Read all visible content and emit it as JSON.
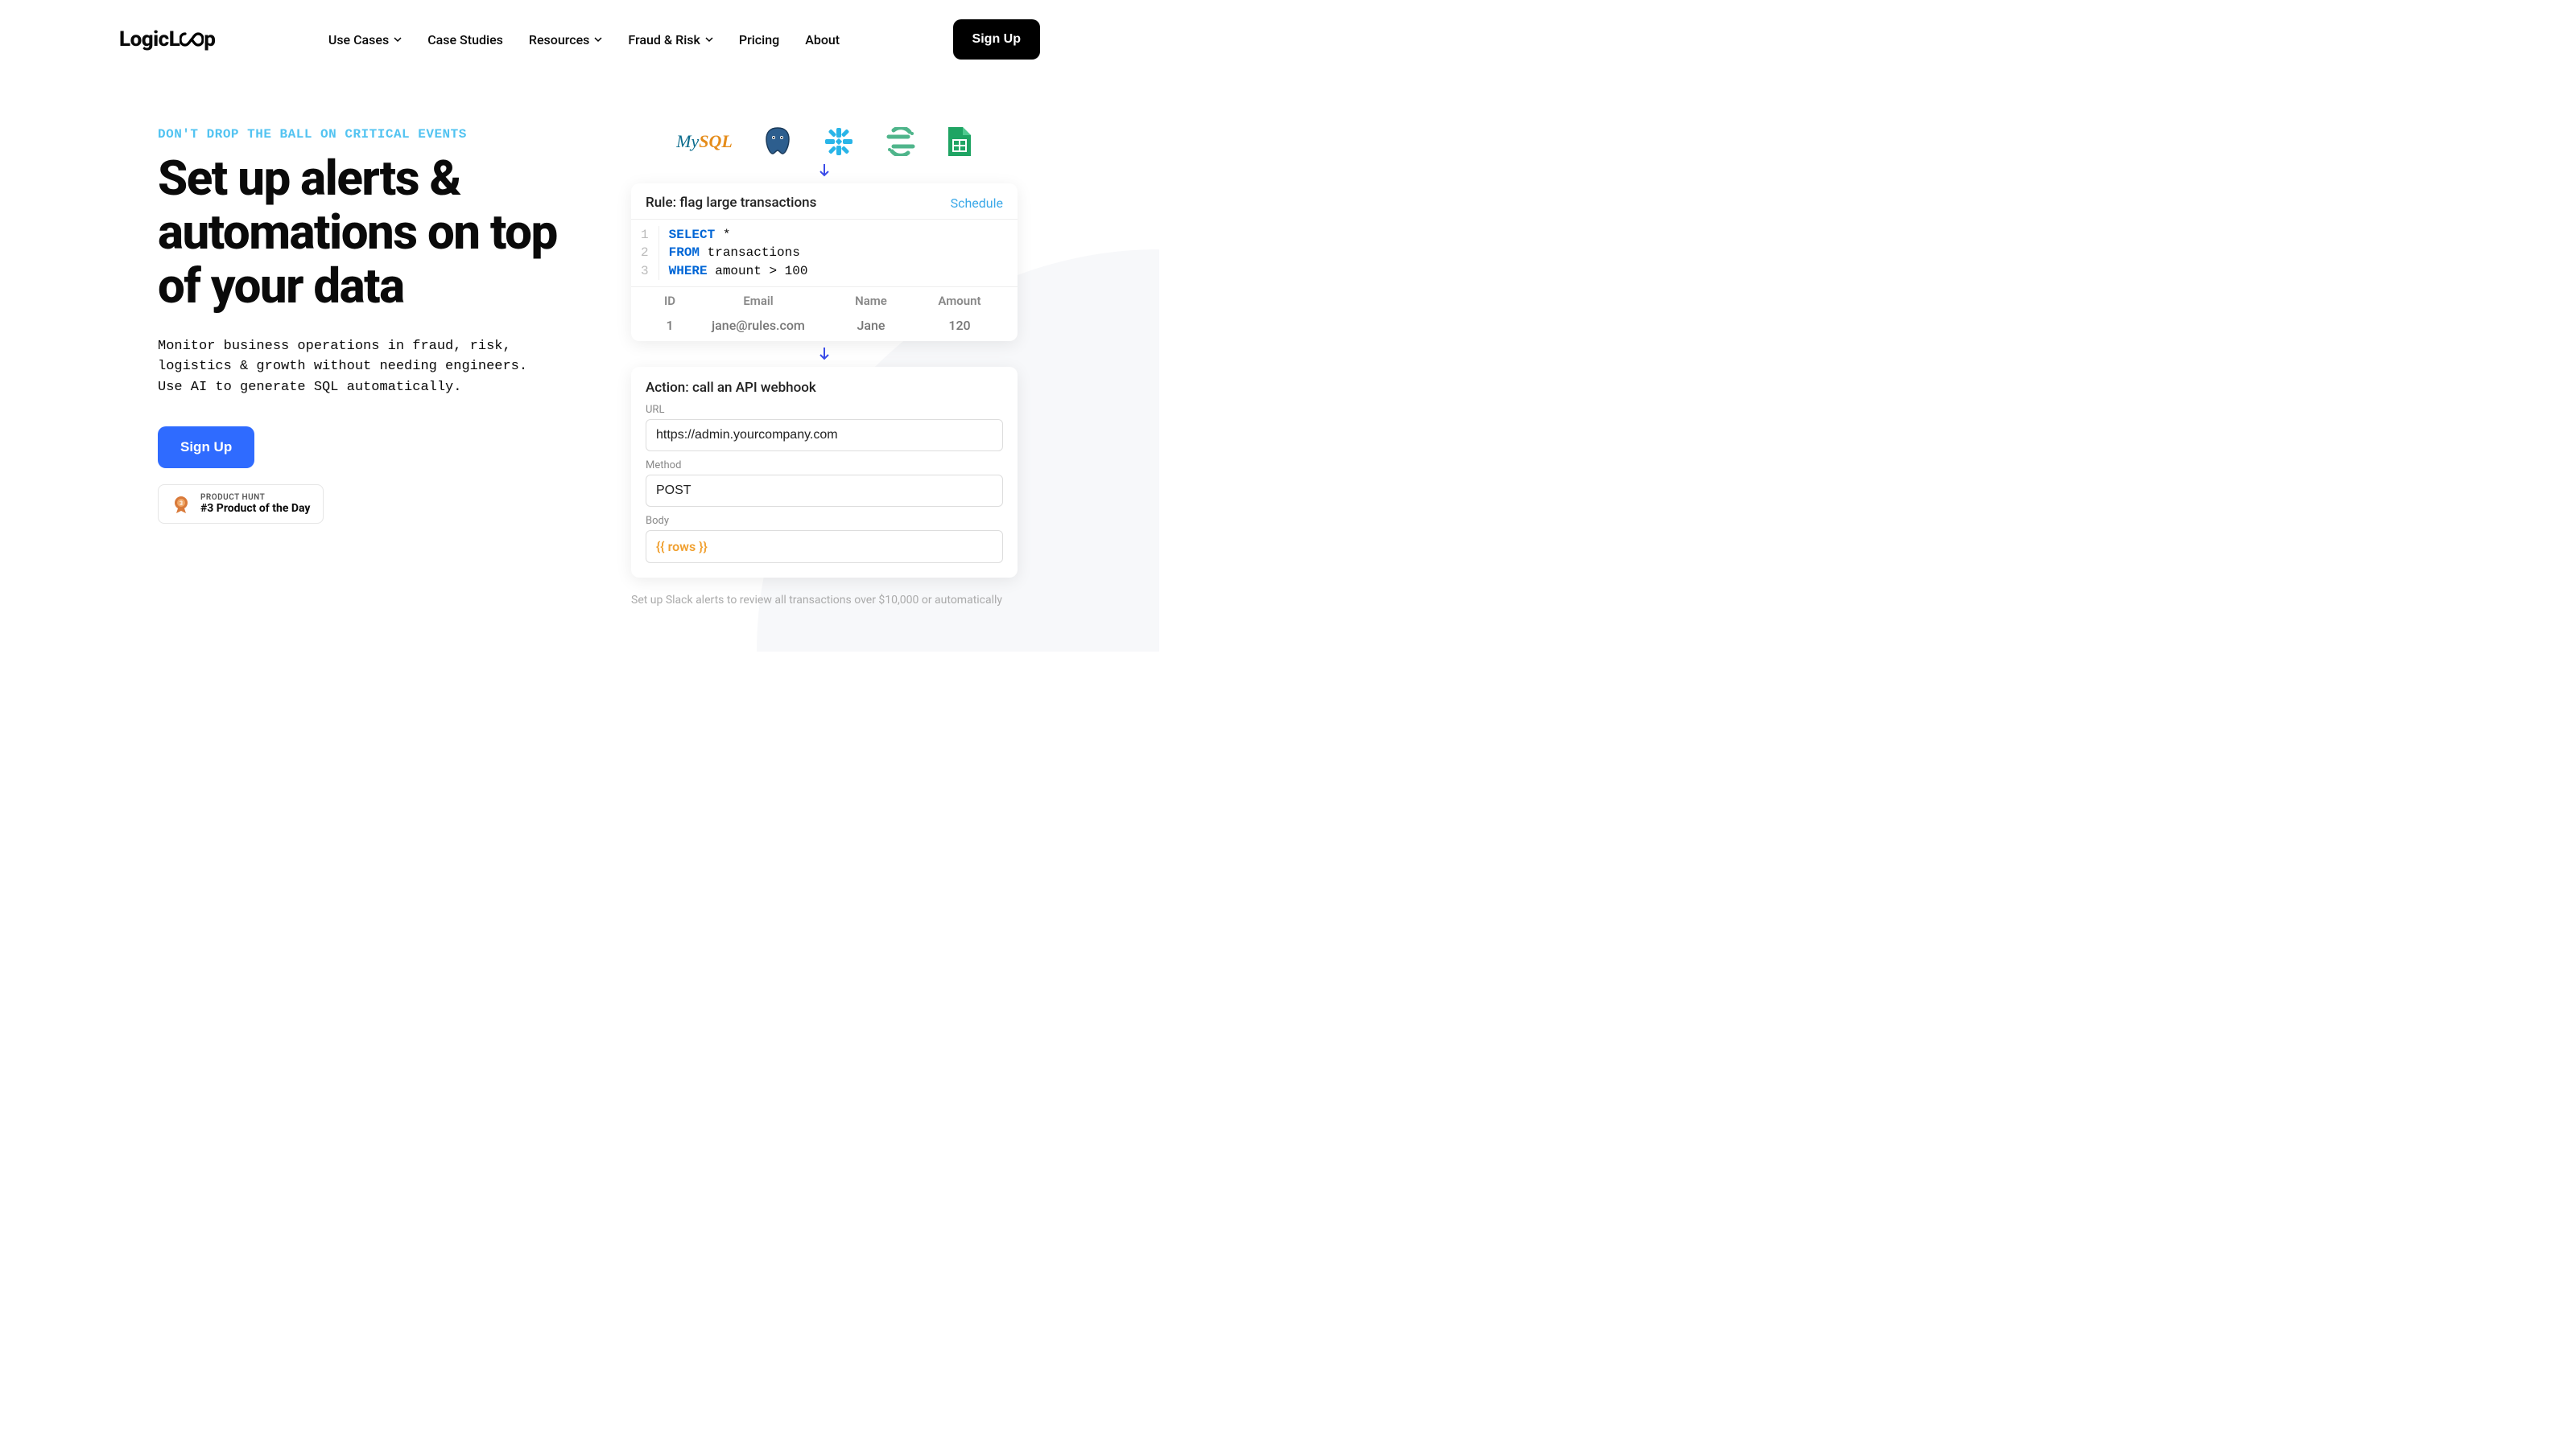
{
  "header": {
    "logo": "LogicLoop",
    "nav": {
      "use_cases": "Use Cases",
      "case_studies": "Case Studies",
      "resources": "Resources",
      "fraud_risk": "Fraud & Risk",
      "pricing": "Pricing",
      "about": "About"
    },
    "signup": "Sign Up"
  },
  "hero": {
    "eyebrow": "DON'T DROP THE BALL ON CRITICAL EVENTS",
    "headline": "Set up alerts & automations on top of your data",
    "subhead": "Monitor business operations in fraud, risk, logistics & growth without needing engineers. Use AI to generate SQL automatically.",
    "cta": "Sign Up",
    "ph_top": "PRODUCT HUNT",
    "ph_bottom": "#3 Product of the Day"
  },
  "visual": {
    "rule_title": "Rule: flag large transactions",
    "schedule": "Schedule",
    "code": {
      "l1_kw": "SELECT",
      "l1_rest": " *",
      "l2_kw": "FROM",
      "l2_rest": " transactions",
      "l3_kw": "WHERE",
      "l3_rest": " amount > 100"
    },
    "table": {
      "h1": "ID",
      "h2": "Email",
      "h3": "Name",
      "h4": "Amount",
      "d1": "1",
      "d2": "jane@rules.com",
      "d3": "Jane",
      "d4": "120"
    },
    "action_title": "Action: call an API webhook",
    "url_label": "URL",
    "url_value": "https://admin.yourcompany.com",
    "method_label": "Method",
    "method_value": "POST",
    "body_label": "Body",
    "body_value": "{{ rows }}",
    "footnote": "Set up Slack alerts to review all transactions over $10,000 or automatically"
  }
}
